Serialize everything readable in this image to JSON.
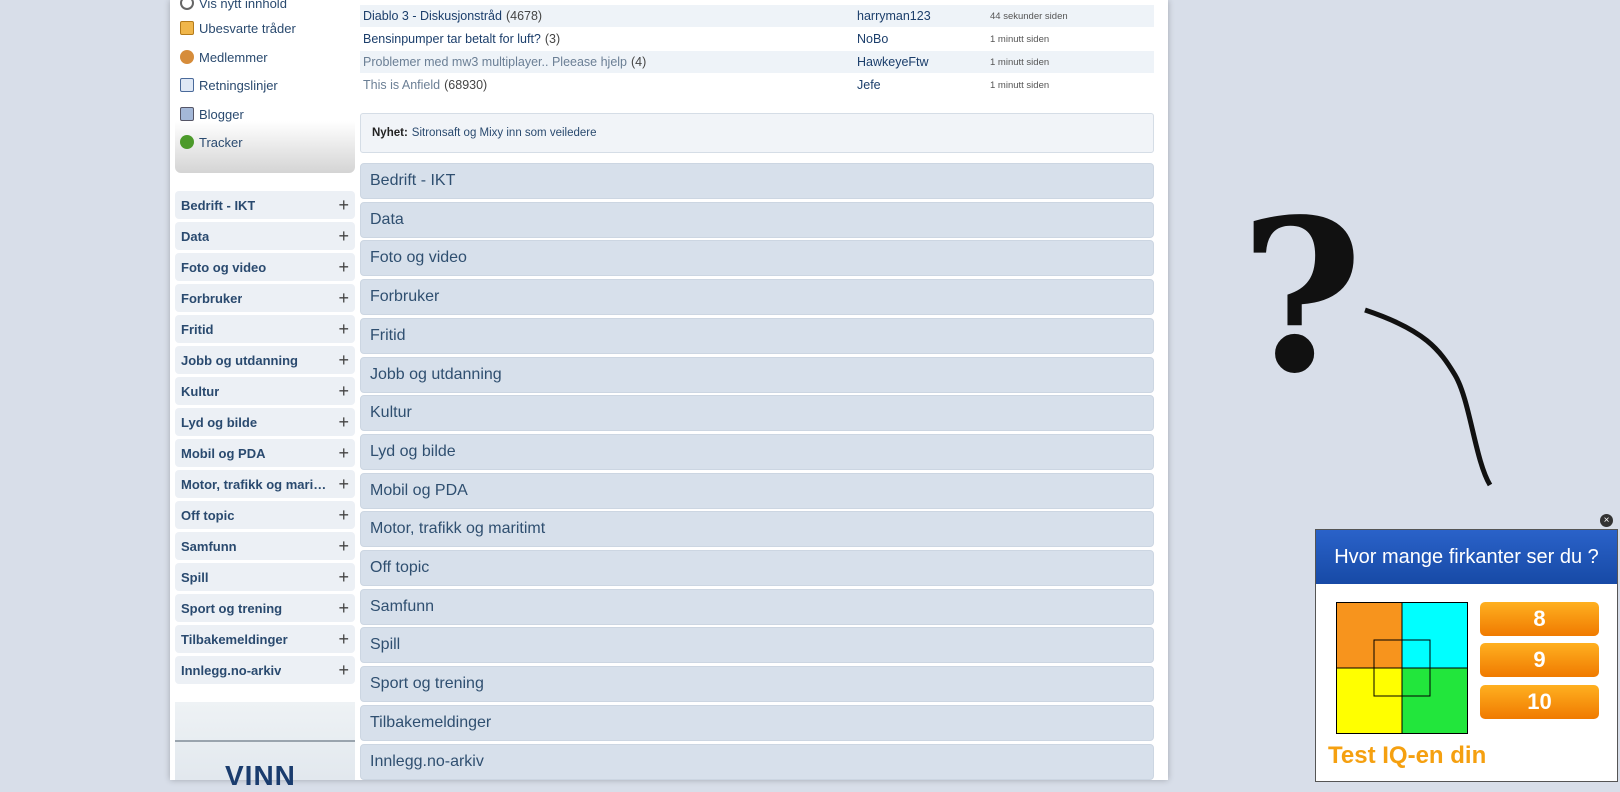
{
  "top_menu": [
    {
      "label": "Vis nytt innhold",
      "icon": "new-content-icon"
    },
    {
      "label": "Ubesvarte tråder",
      "icon": "unanswered-icon"
    },
    {
      "label": "Medlemmer",
      "icon": "members-icon"
    },
    {
      "label": "Retningslinjer",
      "icon": "rules-icon"
    },
    {
      "label": "Blogger",
      "icon": "blogs-icon"
    },
    {
      "label": "Tracker",
      "icon": "tracker-icon"
    }
  ],
  "sidebar_categories": [
    "Bedrift - IKT",
    "Data",
    "Foto og video",
    "Forbruker",
    "Fritid",
    "Jobb og utdanning",
    "Kultur",
    "Lyd og bilde",
    "Mobil og PDA",
    "Motor, trafikk og maritimt",
    "Off topic",
    "Samfunn",
    "Spill",
    "Sport og trening",
    "Tilbakemeldinger",
    "Innlegg.no-arkiv"
  ],
  "threads": [
    {
      "title": "Diablo 3 - Diskusjonstråd",
      "count": "(4678)",
      "user": "harryman123",
      "time": "44 sekunder siden"
    },
    {
      "title": "Bensinpumper tar betalt for luft?",
      "count": "(3)",
      "user": "NoBo",
      "time": "1 minutt siden"
    },
    {
      "title": "Problemer med mw3 multiplayer.. Pleease hjelp",
      "count": "(4)",
      "user": "HawkeyeFtw",
      "time": "1 minutt siden"
    },
    {
      "title": "This is Anfield",
      "count": "(68930)",
      "user": "Jefe",
      "time": "1 minutt siden"
    }
  ],
  "news": {
    "label": "Nyhet:",
    "text": "Sitronsaft og Mixy inn som veiledere"
  },
  "forum_categories": [
    "Bedrift - IKT",
    "Data",
    "Foto og video",
    "Forbruker",
    "Fritid",
    "Jobb og utdanning",
    "Kultur",
    "Lyd og bilde",
    "Mobil og PDA",
    "Motor, trafikk og maritimt",
    "Off topic",
    "Samfunn",
    "Spill",
    "Sport og trening",
    "Tilbakemeldinger",
    "Innlegg.no-arkiv"
  ],
  "left_ad": {
    "text": "VINN"
  },
  "iq_ad": {
    "question": "Hvor mange firkanter ser du ?",
    "options": [
      "8",
      "9",
      "10"
    ],
    "footer": "Test IQ-en din",
    "close": "×"
  },
  "colors": {
    "link": "#1b3e6b",
    "category_bg": "#d7e0eb",
    "ad_orange": "#f07a00",
    "ad_blue": "#1f55b8"
  }
}
